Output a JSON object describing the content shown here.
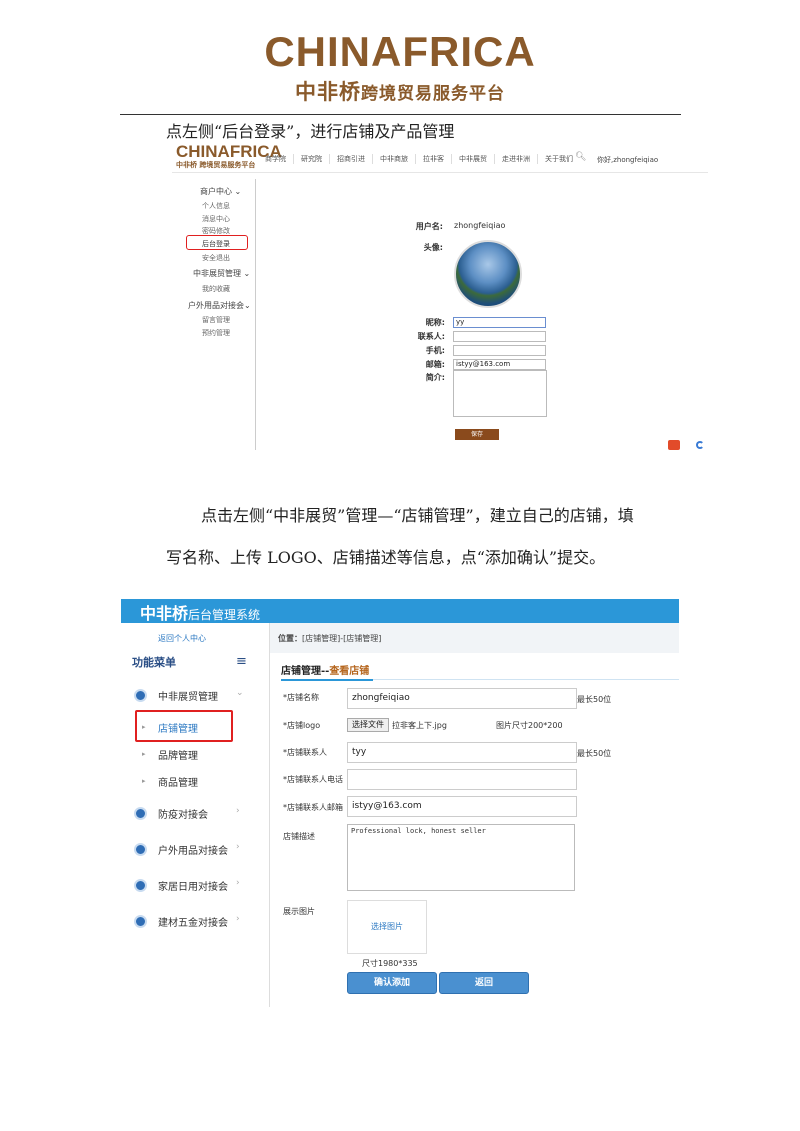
{
  "header": {
    "brand_logo": "CHINAFRICA",
    "brand_cn": "中非桥",
    "brand_sub": "跨境贸易服务平台"
  },
  "paragraph1": "点左侧“后台登录”，进行店铺及产品管理",
  "screenshot1": {
    "logo": "CHINAFRICA",
    "logo_sub": "中非桥 跨境贸易服务平台",
    "nav": [
      "商学院",
      "研究院",
      "招商引进",
      "中非商旅",
      "拉非客",
      "中非展贸",
      "走进非洲",
      "关于我们"
    ],
    "search_icon": "search-icon",
    "user": "你好,zhongfeiqiao",
    "sidebar": {
      "group1": "商户中心",
      "group1_items": [
        "个人信息",
        "消息中心",
        "密码修改",
        "后台登录",
        "安全退出"
      ],
      "group2": "中非展贸管理",
      "group2_items": [
        "我的收藏"
      ],
      "group3": "户外用品对接会",
      "group3_items": [
        "留言管理",
        "预约管理"
      ]
    },
    "form": {
      "username_label": "用户名:",
      "username_value": "zhongfeiqiao",
      "avatar_label": "头像:",
      "nickname_label": "昵称:",
      "nickname_value": "yy",
      "contact_label": "联系人:",
      "phone_label": "手机:",
      "email_label": "邮箱:",
      "email_value": "istyy@163.com",
      "intro_label": "简介:",
      "save_button": "保存"
    }
  },
  "paragraph2_line1": "点击左侧“中非展贸”管理—“店铺管理”，建立自己的店铺，填",
  "paragraph2_line2": "写名称、上传 LOGO、店铺描述等信息，点“添加确认”提交。",
  "screenshot2": {
    "title_cn": "中非桥",
    "title_suffix": "后台管理系统",
    "back_link": "返回个人中心",
    "menu_title": "功能菜单",
    "menu_icon": "menu-icon",
    "groups": [
      "中非展贸管理",
      "防疫对接会",
      "户外用品对接会",
      "家居日用对接会",
      "建材五金对接会"
    ],
    "sub_items": [
      "店铺管理",
      "品牌管理",
      "商品管理"
    ],
    "breadcrumb_label": "位置：",
    "breadcrumb_path": "[店铺管理]-[店铺管理]",
    "section_title": "店铺管理--",
    "section_title_accent": "查看店铺",
    "fields": {
      "name_label": "*店铺名称",
      "name_value": "zhongfeiqiao",
      "name_hint": "最长50位",
      "logo_label": "*店铺logo",
      "file_button": "选择文件",
      "file_name": "拉非客上下.jpg",
      "logo_hint": "图片尺寸200*200",
      "contact_label": "*店铺联系人",
      "contact_value": "tyy",
      "contact_hint": "最长50位",
      "phone_label": "*店铺联系人电话",
      "phone_value": "",
      "email_label": "*店铺联系人邮箱",
      "email_value": "istyy@163.com",
      "desc_label": "店铺描述",
      "desc_value": "Professional lock, honest seller",
      "image_label": "展示图片",
      "image_button": "选择图片",
      "image_size": "尺寸1980*335"
    },
    "confirm_button": "确认添加",
    "back_button": "返回"
  },
  "colors": {
    "brand_brown": "#8a5a2b",
    "admin_blue": "#2b97d8",
    "highlight_red": "#e02020"
  }
}
